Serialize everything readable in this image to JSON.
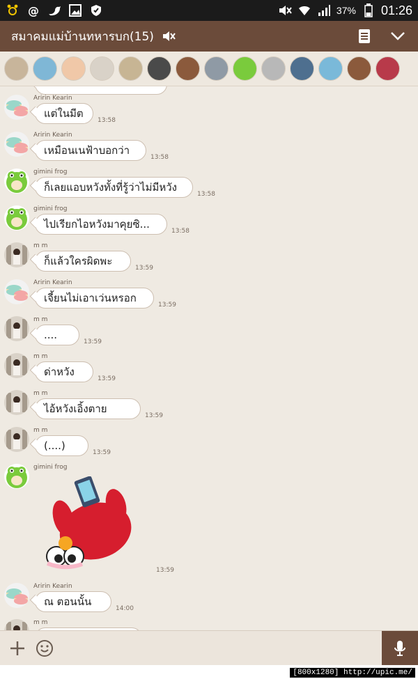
{
  "status_bar": {
    "left_icons": [
      "alarm-icon",
      "at-icon",
      "twitter-icon",
      "gallery-icon",
      "shield-icon"
    ],
    "battery": "37%",
    "time": "01:26"
  },
  "header": {
    "title": "สมาคมแม่บ้านทหารบก(15)",
    "accent": "#6b4b3a"
  },
  "members": {
    "avatar_colors": [
      "#c8b59b",
      "#7fb7d6",
      "#f0c8a8",
      "#d9d2c8",
      "#c7b594",
      "#4a4a4a",
      "#8b5a3c",
      "#8f9aa5",
      "#7acb3c",
      "#b8b8b8",
      "#4e6f8f",
      "#7ab9d9",
      "#8b5a3c",
      "#b83a4a"
    ]
  },
  "messages": [
    {
      "sender": "Aririn Kearin",
      "avatar": "macaron",
      "text": "แต่ในมีต",
      "time": "13:58"
    },
    {
      "sender": "Aririn Kearin",
      "avatar": "macaron",
      "text": "เหมือนเนฟ้าบอกว่า",
      "time": "13:58"
    },
    {
      "sender": "gimini frog",
      "avatar": "frog",
      "text": "ก็เลยแอบหวังทั้งที่รู้ว่าไม่มีหวัง",
      "time": "13:58"
    },
    {
      "sender": "gimini frog",
      "avatar": "frog",
      "text": "ไปเรียกไอหวังมาคุยซิ...",
      "time": "13:58"
    },
    {
      "sender": "m m",
      "avatar": "photo",
      "text": "ก็แล้วใครผิดพะ",
      "time": "13:59"
    },
    {
      "sender": "Aririn Kearin",
      "avatar": "macaron",
      "text": "เจี้ยนไม่เอาเว่นหรอก",
      "time": "13:59"
    },
    {
      "sender": "m m",
      "avatar": "photo",
      "text": "....",
      "time": "13:59"
    },
    {
      "sender": "m m",
      "avatar": "photo",
      "text": "ด่าหวัง",
      "time": "13:59"
    },
    {
      "sender": "m m",
      "avatar": "photo",
      "text": "ไอ้หวังเอิ้งตาย",
      "time": "13:59"
    },
    {
      "sender": "m m",
      "avatar": "photo",
      "text": "(....)",
      "time": "13:59"
    },
    {
      "sender": "gimini frog",
      "avatar": "frog",
      "sticker": true,
      "time": "13:59"
    },
    {
      "sender": "Aririn Kearin",
      "avatar": "macaron",
      "text": "ณ ตอนนั้น",
      "time": "14:00"
    },
    {
      "sender": "m m",
      "avatar": "photo",
      "text": "",
      "time": ""
    }
  ],
  "watermark": "[800x1280] http://upic.me/"
}
